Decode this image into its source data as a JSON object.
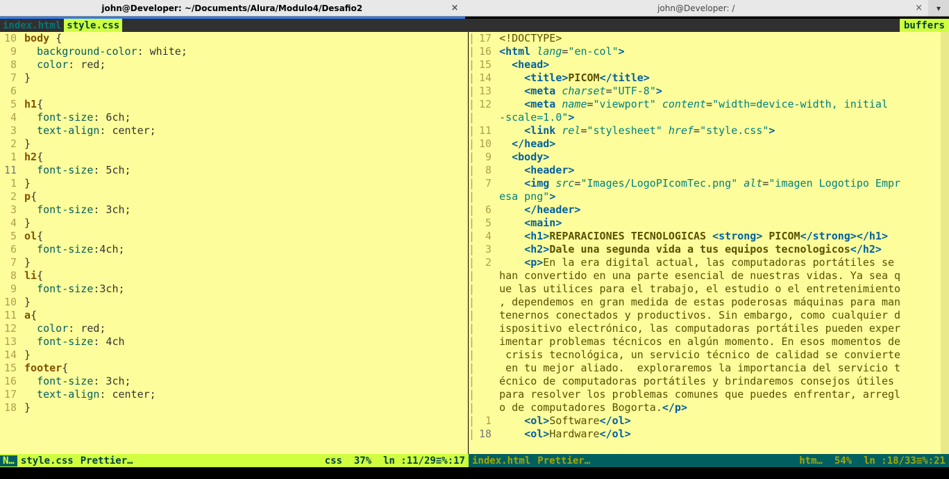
{
  "window": {
    "tabs": [
      {
        "title": "john@Developer: ~/Documents/Alura/Modulo4/Desafio2",
        "active": true
      },
      {
        "title": "john@Developer: /",
        "active": false
      }
    ]
  },
  "buffer_tabs": {
    "left": [
      {
        "label": "index.html",
        "active": false
      },
      {
        "label": "style.css",
        "active": true
      }
    ],
    "right_label": "buffers"
  },
  "left_status": {
    "mode": "N…",
    "filename": "style.css",
    "linter": "Prettier…",
    "filetype": "css",
    "percent": "37%",
    "position": "ln :11/29≡%:17"
  },
  "right_status": {
    "filename": "index.html",
    "linter": "Prettier…",
    "filetype": "htm…",
    "percent": "54%",
    "position": "ln :18/33≡%:21"
  },
  "css_file": {
    "lines": [
      [
        10,
        "body {"
      ],
      [
        9,
        "  background-color: white;"
      ],
      [
        8,
        "  color: red;"
      ],
      [
        7,
        "}"
      ],
      [
        6,
        ""
      ],
      [
        5,
        "h1{"
      ],
      [
        4,
        "  font-size: 6ch;"
      ],
      [
        3,
        "  text-align: center;"
      ],
      [
        2,
        "}"
      ],
      [
        1,
        "h2{"
      ],
      [
        11,
        "  font-size: 5ch;"
      ],
      [
        1,
        "}"
      ],
      [
        2,
        "p{"
      ],
      [
        3,
        "  font-size: 3ch;"
      ],
      [
        4,
        "}"
      ],
      [
        5,
        "ol{"
      ],
      [
        6,
        "  font-size:4ch;"
      ],
      [
        7,
        "}"
      ],
      [
        8,
        "li{"
      ],
      [
        9,
        "  font-size:3ch;"
      ],
      [
        10,
        "}"
      ],
      [
        11,
        "a{"
      ],
      [
        12,
        "  color: red;"
      ],
      [
        13,
        "  font-size: 4ch"
      ],
      [
        14,
        "}"
      ],
      [
        15,
        "footer{"
      ],
      [
        16,
        "  font-size: 3ch;"
      ],
      [
        17,
        "  text-align: center;"
      ],
      [
        18,
        "}"
      ]
    ]
  },
  "html_file": {
    "doctype": "<!DOCTYPE>",
    "lang": "en-col",
    "title": "PICOM",
    "charset": "UTF-8",
    "viewport": "width=device-width, initial-scale=1.0",
    "stylesheet": "style.css",
    "img_src": "Images/LogoPIcomTec.png",
    "img_alt": "imagen Logotipo Empresa png",
    "h1_main": "REPARACIONES TECNOLOGICAS ",
    "h1_strong": " PICOM",
    "h2": "Dale una segunda vida a tus equipos tecnologicos",
    "paragraph": "En la era digital actual, las computadoras portátiles se han convertido en una parte esencial de nuestras vidas. Ya sea que las utilices para el trabajo, el estudio o el entretenimiento, dependemos en gran medida de estas poderosas máquinas para mantenernos conectados y productivos. Sin embargo, como cualquier dispositivo electrónico, las computadoras portátiles pueden experimentar problemas técnicos en algún momento. En esos momentos de crisis tecnológica, un servicio técnico de calidad se convierte en tu mejor aliado.  exploraremos la importancia del servicio técnico de computadoras portátiles y brindaremos consejos útiles para resolver los problemas comunes que puedes enfrentar, arreglo de computadores Bogorta.",
    "ol1": "Software",
    "ol2": "Hardware",
    "line_numbers": [
      17,
      16,
      15,
      14,
      13,
      12,
      "",
      11,
      10,
      9,
      8,
      7,
      "",
      6,
      5,
      4,
      3,
      2,
      "",
      "",
      "",
      "",
      "",
      "",
      "",
      "",
      "",
      "",
      1,
      18
    ]
  }
}
